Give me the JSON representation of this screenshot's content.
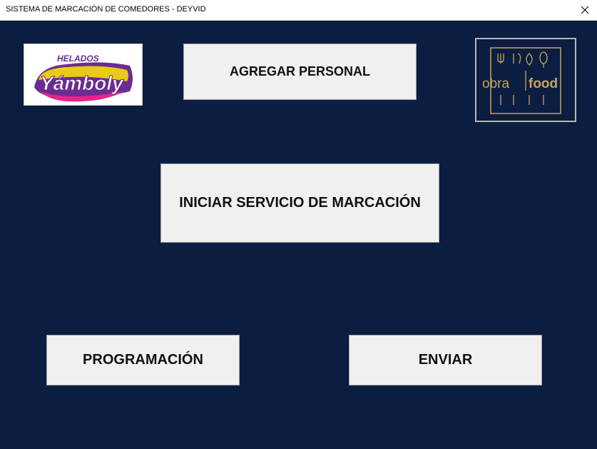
{
  "window": {
    "title": "SISTEMA DE MARCACIÓN DE COMEDORES - DEYVID"
  },
  "buttons": {
    "agregar_personal": "AGREGAR PERSONAL",
    "iniciar_servicio": "INICIAR SERVICIO DE MARCACIÓN",
    "programacion": "PROGRAMACIÓN",
    "enviar": "ENVIAR"
  },
  "logos": {
    "yamboly": {
      "tagline": "HELADOS",
      "brand": "Yámboly"
    },
    "obrafood": {
      "word1": "obra",
      "word2": "food"
    }
  },
  "colors": {
    "background": "#0b1d40",
    "button_face": "#f0f0f0",
    "yamboly_purple": "#6b2c91",
    "yamboly_yellow": "#ffe600",
    "yamboly_pink": "#e8238b",
    "obrafood_gold": "#c9a45a"
  },
  "icons": {
    "close": "close-icon"
  }
}
